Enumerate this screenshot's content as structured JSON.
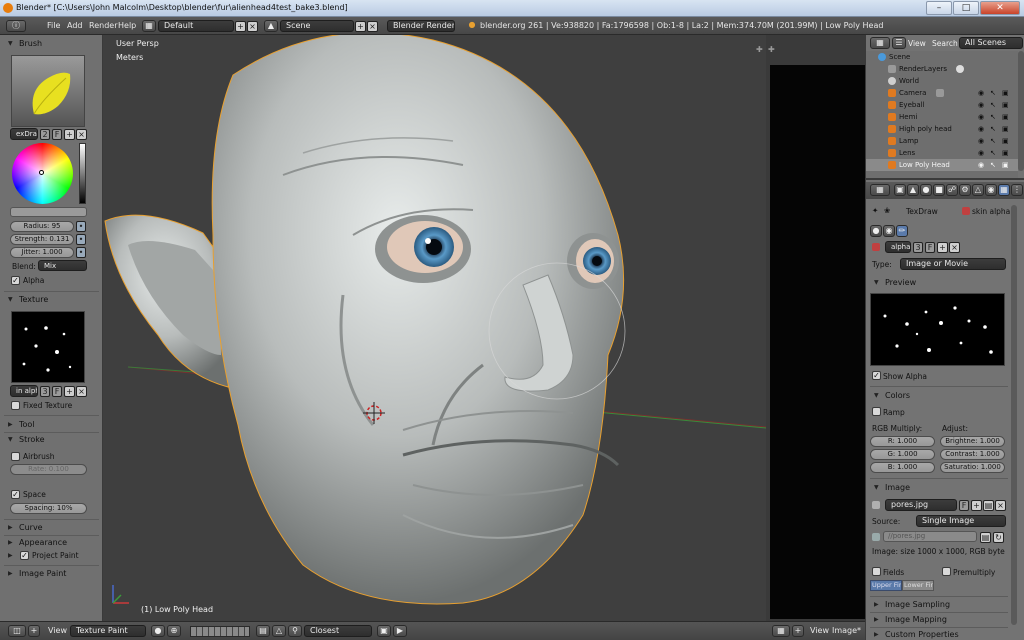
{
  "titlebar": {
    "title": "Blender* [C:\\Users\\John Malcolm\\Desktop\\blender\\fur\\alienhead4test_bake3.blend]"
  },
  "menubar": {
    "menus": [
      "File",
      "Add",
      "Render",
      "Help"
    ],
    "screen_layout": "Default",
    "scene": "Scene",
    "render_engine": "Blender Render",
    "stats": "blender.org 261 | Ve:938820 | Fa:1796598 | Ob:1-8 | La:2 | Mem:374.70M (201.99M) | Low Poly Head"
  },
  "left_panel": {
    "brush": {
      "header": "Brush",
      "name": "exDraw",
      "users": "2",
      "fake_user": "F",
      "radius_label": "Radius: 95",
      "strength_label": "Strength: 0.131",
      "jitter_label": "Jitter: 1.000",
      "blend_label": "Blend:",
      "blend_value": "Mix",
      "alpha_label": "Alpha"
    },
    "texture": {
      "header": "Texture",
      "name": "in alpha",
      "users": "3",
      "fake_user": "F",
      "fixed_texture_label": "Fixed Texture"
    },
    "tool_header": "Tool",
    "stroke": {
      "header": "Stroke",
      "airbrush_label": "Airbrush",
      "rate_label": "Rate: 0.100",
      "space_label": "Space",
      "spacing_label": "Spacing: 10%"
    },
    "curve_header": "Curve",
    "appearance_header": "Appearance",
    "project_paint_label": "Project Paint",
    "image_paint_header": "Image Paint"
  },
  "viewport": {
    "view_name": "User Persp",
    "units": "Meters",
    "object_label": "(1) Low Poly Head"
  },
  "outliner": {
    "view": "View",
    "search": "Search",
    "filter": "All Scenes",
    "items": [
      {
        "label": "Scene",
        "color": "#4a9adc"
      },
      {
        "label": "RenderLayers",
        "color": "#9a9a9a"
      },
      {
        "label": "World",
        "color": "#cfcfcf"
      },
      {
        "label": "Camera",
        "color": "#e07a20"
      },
      {
        "label": "Eyeball",
        "color": "#e07a20"
      },
      {
        "label": "Hemi",
        "color": "#e07a20"
      },
      {
        "label": "High poly head",
        "color": "#e07a20"
      },
      {
        "label": "Lamp",
        "color": "#e07a20"
      },
      {
        "label": "Lens",
        "color": "#e07a20"
      },
      {
        "label": "Low Poly Head",
        "color": "#e07a20"
      }
    ]
  },
  "properties": {
    "breadcrumb_brush": "TexDraw",
    "breadcrumb_texture": "skin alpha",
    "texture_name": "alpha",
    "users": "3",
    "fake_user": "F",
    "type_label": "Type:",
    "type_value": "Image or Movie",
    "preview_header": "Preview",
    "show_alpha_label": "Show Alpha",
    "colors_header": "Colors",
    "ramp_label": "Ramp",
    "rgb_multiply_label": "RGB Multiply:",
    "adjust_label": "Adjust:",
    "r_label": "R: 1.000",
    "g_label": "G: 1.000",
    "b_label": "B: 1.000",
    "brightness_label": "Brightne: 1.000",
    "contrast_label": "Contrast: 1.000",
    "saturation_label": "Saturatio: 1.000",
    "image_header": "Image",
    "image_name": "pores.jpg",
    "image_fake": "F",
    "source_label": "Source:",
    "source_value": "Single Image",
    "filepath": "//pores.jpg",
    "image_info": "Image: size 1000 x 1000, RGB byte",
    "fields_label": "Fields",
    "premultiply_label": "Premultiply",
    "upper_first": "Upper First",
    "lower_first": "Lower First",
    "image_sampling_header": "Image Sampling",
    "image_mapping_header": "Image Mapping",
    "custom_properties_header": "Custom Properties"
  },
  "render_view": {
    "view": "View",
    "image": "Image*"
  },
  "bottombar": {
    "view": "View",
    "mode": "Texture Paint",
    "pivot": "Closest"
  },
  "colors": {
    "panel_bg": "#707070",
    "viewport_bg": "#3f3f3f",
    "selection_orange": "#e8a030",
    "titlebar_blue": "#c9d7ea"
  }
}
